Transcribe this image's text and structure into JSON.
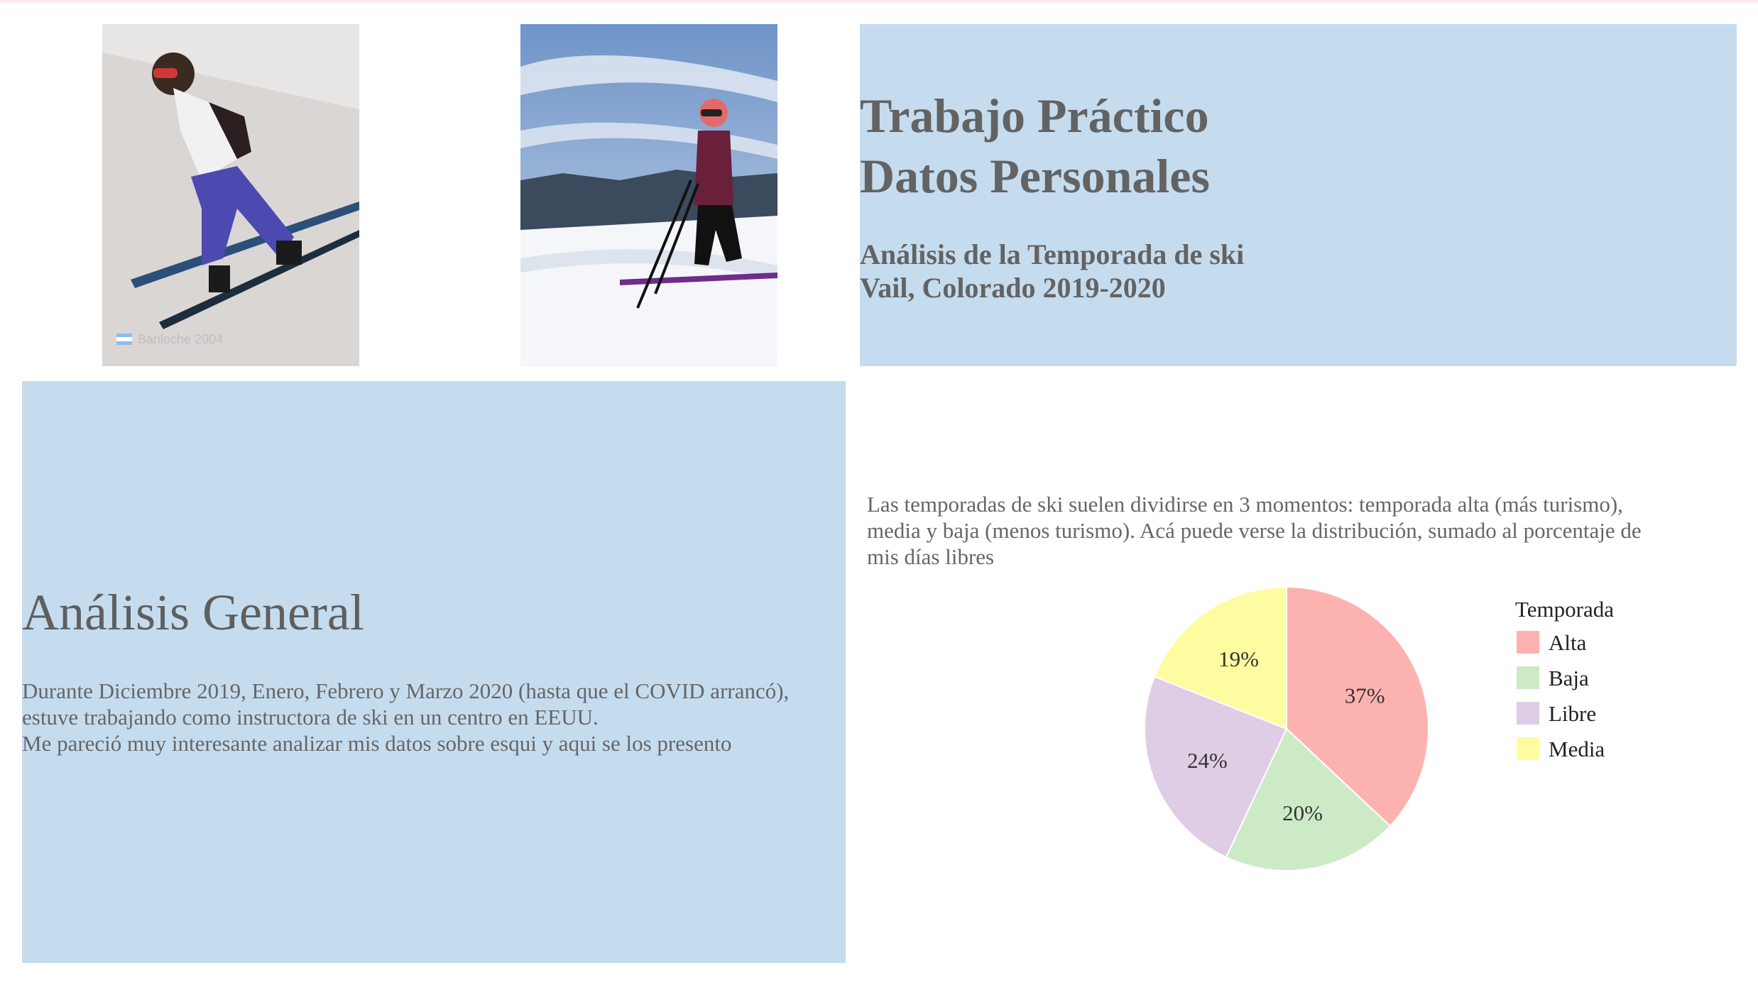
{
  "header": {
    "title_line1": "Trabajo Práctico",
    "title_line2": "Datos Personales",
    "subtitle_line1": "Análisis de la Temporada de ski",
    "subtitle_line2": "Vail, Colorado 2019-2020"
  },
  "photos": {
    "left_caption": "Bariloche 2004",
    "left_flag_icon": "argentina-flag-icon"
  },
  "analysis": {
    "heading": "Análisis General",
    "line1": "Durante Diciembre 2019, Enero, Febrero y Marzo 2020 (hasta que el COVID arrancó),",
    "line2": "estuve trabajando como  instructora de ski en un centro en EEUU.",
    "line3": "Me pareció muy interesante analizar mis datos sobre  esqui y aqui se los presento"
  },
  "description": {
    "line1": "Las temporadas de ski suelen dividirse en 3 momentos: temporada alta (más turismo),",
    "line2": "media y baja (menos turismo).  Acá puede verse la distribución, sumado al porcentaje de",
    "line3": "mis días libres"
  },
  "colors": {
    "panel_blue": "#c5dcef",
    "text_gray": "#636363",
    "alta": "#fcb3b0",
    "baja": "#cdeac7",
    "libre": "#decde5",
    "media": "#fefca0"
  },
  "chart_data": {
    "type": "pie",
    "legend_title": "Temporada",
    "legend_position": "right",
    "categories": [
      "Alta",
      "Baja",
      "Libre",
      "Media"
    ],
    "values": [
      37,
      20,
      24,
      19
    ],
    "labels": [
      "37%",
      "20%",
      "24%",
      "19%"
    ],
    "colors": [
      "#fcb3b0",
      "#cdeac7",
      "#decde5",
      "#fefca0"
    ]
  }
}
